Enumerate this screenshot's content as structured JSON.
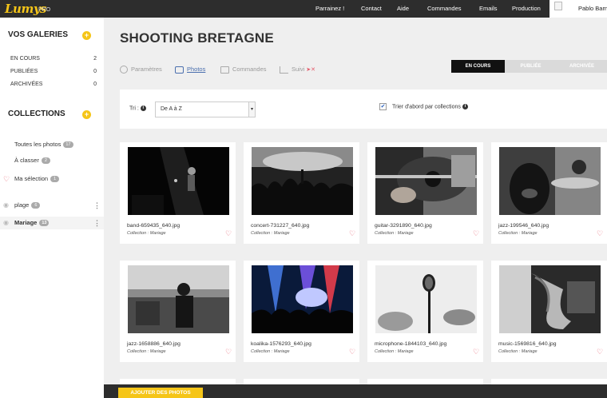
{
  "app": {
    "logo": "Lumys",
    "logo_badge": "PRO"
  },
  "topnav": {
    "items": [
      "Parrainez !",
      "Contact",
      "Aide",
      "Commandes",
      "Emails",
      "Production"
    ],
    "user_name": "Pablo Barn"
  },
  "sidebar": {
    "galleries_title": "VOS GALERIES",
    "galleries": [
      {
        "label": "EN COURS",
        "count": "2"
      },
      {
        "label": "PUBLIÉES",
        "count": "0"
      },
      {
        "label": "ARCHIVÉES",
        "count": "0"
      }
    ],
    "collections_title": "COLLECTIONS",
    "filters": [
      {
        "label": "Toutes les photos",
        "count": "17"
      },
      {
        "label": "À classer",
        "count": "2"
      },
      {
        "label": "Ma sélection",
        "count": "1"
      }
    ],
    "collections": [
      {
        "label": "plage",
        "count": "6"
      },
      {
        "label": "Mariage",
        "count": "13"
      }
    ]
  },
  "gallery": {
    "title": "SHOOTING BRETAGNE",
    "tabs": [
      "Paramètres",
      "Photos",
      "Commandes",
      "Suivi"
    ],
    "active_tab": "Photos",
    "status": [
      "EN COURS",
      "PUBLIÉE",
      "ARCHIVÉE"
    ],
    "active_status": "EN COURS"
  },
  "filters": {
    "sort_label": "Tri :",
    "sort_value": "De A à Z",
    "group_label": "Trier d'abord par collections",
    "group_checked": true
  },
  "photos": [
    {
      "name": "band-659435_640.jpg",
      "collection": "Collection : Mariage"
    },
    {
      "name": "concert-731227_640.jpg",
      "collection": "Collection : Mariage"
    },
    {
      "name": "guitar-3291890_640.jpg",
      "collection": "Collection : Mariage"
    },
    {
      "name": "jazz-199546_640.jpg",
      "collection": "Collection : Mariage"
    },
    {
      "name": "jazz-1658886_640.jpg",
      "collection": "Collection : Mariage"
    },
    {
      "name": "koalika-1576293_640.jpg",
      "collection": "Collection : Mariage"
    },
    {
      "name": "microphone-1844103_640.jpg",
      "collection": "Collection : Mariage"
    },
    {
      "name": "music-1569816_640.jpg",
      "collection": "Collection : Mariage"
    }
  ],
  "actions": {
    "add_photos": "AJOUTER DES PHOTOS"
  },
  "colors": {
    "accent": "#f5c518",
    "topbar": "#2d2d2d",
    "heart": "#e45a6a",
    "link": "#4a6fae"
  }
}
